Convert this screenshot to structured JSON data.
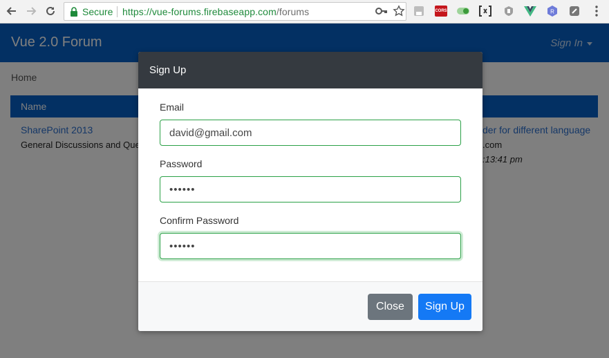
{
  "browser": {
    "secure_label": "Secure",
    "url_host": "https://vue-forums.firebaseapp.com",
    "url_path": "/forums",
    "cors_label": "CORS"
  },
  "page": {
    "brand": "Vue 2.0 Forum",
    "signin": "Sign In",
    "breadcrumb": "Home",
    "table": {
      "header_name": "Name",
      "rows": [
        {
          "title": "SharePoint 2013",
          "description": "General Discussions and Que"
        }
      ],
      "right_partial": {
        "link": "der for different language",
        "user": ".com",
        "time": ":13:41 pm"
      }
    }
  },
  "modal": {
    "title": "Sign Up",
    "email_label": "Email",
    "email_value": "david@gmail.com",
    "password_label": "Password",
    "password_value": "••••••",
    "confirm_label": "Confirm Password",
    "confirm_value": "••••••",
    "close_label": "Close",
    "signup_label": "Sign Up"
  },
  "colors": {
    "navbar": "#0761c7",
    "modal_header": "#353a40",
    "valid_border": "#2aa046",
    "primary": "#1479f5",
    "secondary": "#6c757d"
  }
}
